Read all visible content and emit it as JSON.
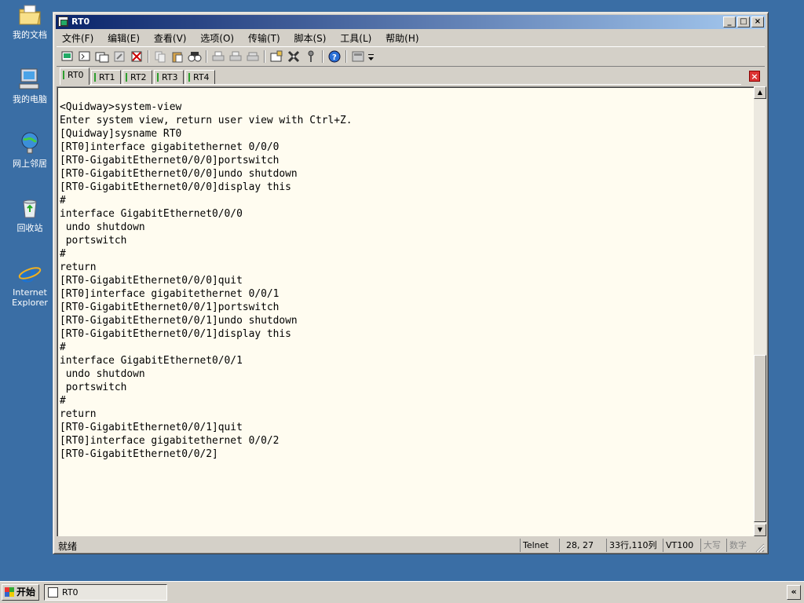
{
  "desktop": {
    "icons": [
      {
        "label": "我的文档",
        "icon": "my-documents-folder-icon"
      },
      {
        "label": "我的电脑",
        "icon": "my-computer-icon"
      },
      {
        "label": "网上邻居",
        "icon": "network-places-icon"
      },
      {
        "label": "回收站",
        "icon": "recycle-bin-icon"
      },
      {
        "label": "Internet Explorer",
        "icon": "internet-explorer-icon"
      }
    ]
  },
  "window": {
    "title": "RT0",
    "buttons": {
      "minimize": "_",
      "maximize": "□",
      "close": "×"
    }
  },
  "menu": [
    "文件(F)",
    "编辑(E)",
    "查看(V)",
    "选项(O)",
    "传输(T)",
    "脚本(S)",
    "工具(L)",
    "帮助(H)"
  ],
  "toolbar_icons": [
    "new-session-icon",
    "new-session-wizard-icon",
    "open-folder-icon",
    "reconnect-icon",
    "disconnect-icon",
    "copy-icon",
    "paste-icon",
    "find-icon",
    "print-icon",
    "print-setup-icon",
    "print-screen-icon",
    "properties-icon",
    "settings-icon",
    "keymap-icon",
    "help-icon",
    "view-toggle-icon",
    "toolbar-overflow-icon"
  ],
  "tabs": [
    {
      "label": "RT0",
      "active": true
    },
    {
      "label": "RT1",
      "active": false
    },
    {
      "label": "RT2",
      "active": false
    },
    {
      "label": "RT3",
      "active": false
    },
    {
      "label": "RT4",
      "active": false
    }
  ],
  "terminal": {
    "text": "<Quidway>system-view\nEnter system view, return user view with Ctrl+Z.\n[Quidway]sysname RT0\n[RT0]interface gigabitethernet 0/0/0\n[RT0-GigabitEthernet0/0/0]portswitch\n[RT0-GigabitEthernet0/0/0]undo shutdown\n[RT0-GigabitEthernet0/0/0]display this\n#\ninterface GigabitEthernet0/0/0\n undo shutdown\n portswitch\n#\nreturn\n[RT0-GigabitEthernet0/0/0]quit\n[RT0]interface gigabitethernet 0/0/1\n[RT0-GigabitEthernet0/0/1]portswitch\n[RT0-GigabitEthernet0/0/1]undo shutdown\n[RT0-GigabitEthernet0/0/1]display this\n#\ninterface GigabitEthernet0/0/1\n undo shutdown\n portswitch\n#\nreturn\n[RT0-GigabitEthernet0/0/1]quit\n[RT0]interface gigabitethernet 0/0/2\n[RT0-GigabitEthernet0/0/2]"
  },
  "statusbar": {
    "status": "就绪",
    "protocol": "Telnet",
    "cursor": "28,  27",
    "size": "33行,110列",
    "emulation": "VT100",
    "caps": "大写",
    "num": "数字"
  },
  "taskbar": {
    "start_label": "开始",
    "task_label": "RT0",
    "tray_button": "«"
  }
}
